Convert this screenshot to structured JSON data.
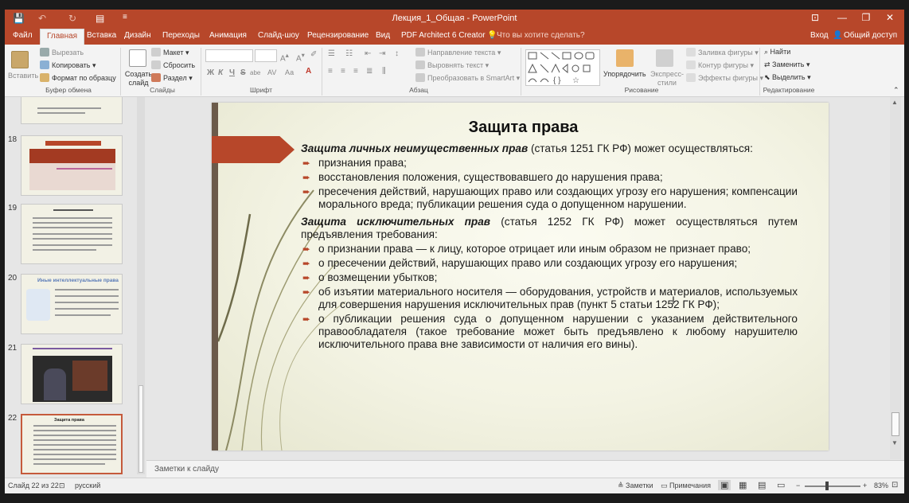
{
  "window": {
    "title": "Лекция_1_Общая - PowerPoint",
    "quick_access": [
      "💾",
      "↶",
      "↻",
      "▤",
      "≡"
    ],
    "controls": [
      "⊡",
      "—",
      "❐",
      "✕"
    ]
  },
  "tabs": {
    "file": "Файл",
    "items": [
      "Главная",
      "Вставка",
      "Дизайн",
      "Переходы",
      "Анимация",
      "Слайд-шоу",
      "Рецензирование",
      "Вид",
      "PDF Architect 6 Creator"
    ],
    "active": "Главная",
    "tell_me": "Что вы хотите сделать?",
    "sign_in": "Вход",
    "share": "Общий доступ"
  },
  "ribbon": {
    "clipboard": {
      "paste": "Вставить",
      "cut": "Вырезать",
      "copy": "Копировать",
      "format_painter": "Формат по образцу",
      "label": "Буфер обмена"
    },
    "slides": {
      "new_slide": "Создать слайд",
      "layout": "Макет",
      "reset": "Сбросить",
      "section": "Раздел",
      "label": "Слайды"
    },
    "font": {
      "bold": "Ж",
      "italic": "К",
      "underline": "Ч",
      "strike": "S",
      "shadow": "abe",
      "spacing": "AV",
      "case": "Аа",
      "label": "Шрифт"
    },
    "paragraph": {
      "text_direction": "Направление текста",
      "align_text": "Выровнять текст",
      "smartart": "Преобразовать в SmartArt",
      "label": "Абзац"
    },
    "drawing": {
      "arrange": "Упорядочить",
      "quick_styles": "Экспресс-стили",
      "fill": "Заливка фигуры",
      "outline": "Контур фигуры",
      "effects": "Эффекты фигуры",
      "label": "Рисование"
    },
    "editing": {
      "find": "Найти",
      "replace": "Заменить",
      "select": "Выделить",
      "label": "Редактирование"
    }
  },
  "thumbnails": [
    {
      "number": "18",
      "kind": "table"
    },
    {
      "number": "19",
      "kind": "text"
    },
    {
      "number": "20",
      "kind": "image-text",
      "caption": "Иные интеллектуальные права"
    },
    {
      "number": "21",
      "kind": "video"
    },
    {
      "number": "22",
      "kind": "text",
      "selected": true,
      "caption": "Защита права"
    }
  ],
  "slide": {
    "title": "Защита права",
    "intro1_bold": "Защита личных неимущественных прав",
    "intro1_rest": " (статья 1251 ГК РФ) может осуществляться:",
    "list1": [
      "признания права;",
      "восстановления положения, существовавшего до нарушения права;",
      "пресечения действий, нарушающих право или создающих угрозу его нарушения; компенсации морального вреда; публикации решения суда о допущенном нарушении."
    ],
    "intro2_bold": "Защита исключительных прав",
    "intro2_rest": " (статья 1252 ГК РФ) может осуществляться путем предъявления требования:",
    "list2": [
      "о признании права — к лицу, которое отрицает или иным образом не признает право;",
      "о пресечении действий, нарушающих право или создающих угрозу его нарушения;",
      "о возмещении убытков;",
      "об изъятии материального носителя — оборудования, устройств и материалов, используемых для совершения нарушения исключительных прав (пункт 5 статьи 1252 ГК РФ);",
      "о публикации решения суда о допущенном нарушении с указанием действительного правообладателя (такое требование может быть предъявлено к любому нарушителю исключительного права вне зависимости от наличия его вины)."
    ],
    "bullet_glyph": "➨",
    "accent": "#b7472a"
  },
  "notes_placeholder": "Заметки к слайду",
  "status": {
    "slide_info": "Слайд 22 из 22",
    "language": "русский",
    "notes_btn": "Заметки",
    "comments_btn": "Примечания",
    "zoom": "83%"
  },
  "colors": {
    "brand": "#b7472a",
    "ribbon_bg": "#f3f3f3",
    "app_bg": "#e6e6e6"
  }
}
